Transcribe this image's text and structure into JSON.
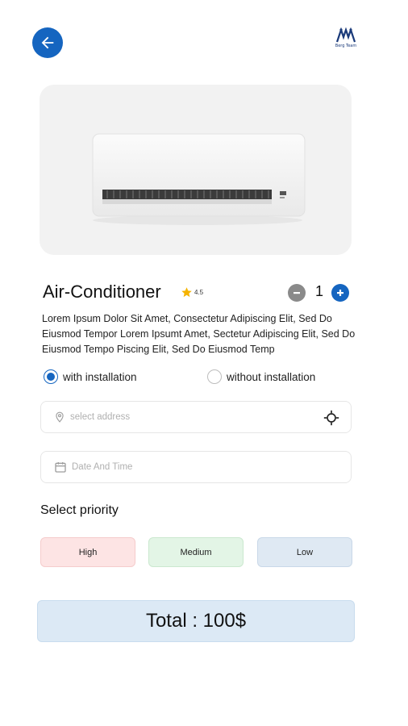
{
  "header": {
    "back_icon": "arrow-left-icon",
    "logo_text": "Berg Team"
  },
  "product": {
    "image_icon": "air-conditioner-image",
    "title": "Air-Conditioner",
    "rating": "4.5",
    "quantity": "1",
    "description": "Lorem Ipsum Dolor Sit Amet, Consectetur Adipiscing Elit, Sed Do Eiusmod Tempor Lorem Ipsumt Amet, Sectetur Adipiscing Elit, Sed Do Eiusmod Tempo Piscing Elit, Sed Do Eiusmod Temp"
  },
  "installation": {
    "with_label": "with installation",
    "without_label": "without installation",
    "selected": "with"
  },
  "form": {
    "address_placeholder": "select address",
    "datetime_placeholder": "Date And Time"
  },
  "priority": {
    "title": "Select priority",
    "options": [
      "High",
      "Medium",
      "Low"
    ]
  },
  "total": {
    "label": "Total : 100$"
  },
  "colors": {
    "accent": "#1565c0",
    "high": "#fde4e4",
    "medium": "#e3f5e6",
    "low": "#dfe9f3",
    "star": "#f5b301"
  }
}
